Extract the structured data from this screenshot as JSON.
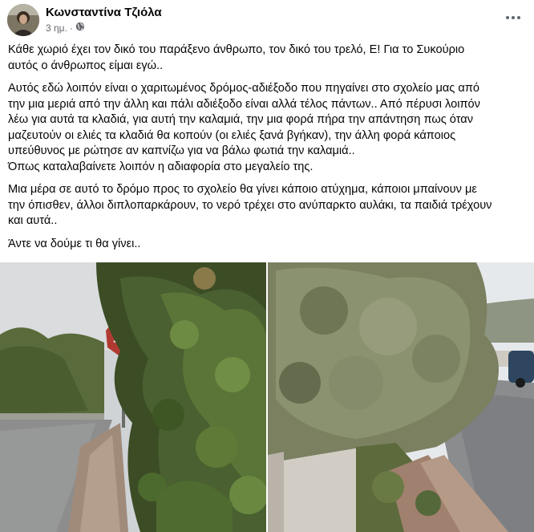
{
  "post": {
    "author": "Κωνσταντίνα Τζιόλα",
    "time": "3 ημ.",
    "separator": "·",
    "paragraphs": [
      "Κάθε χωριό έχει τον δικό του παράξενο άνθρωπο, τον δικό του τρελό, Ε! Για το Συκούριο\nαυτός ο άνθρωπος είμαι εγώ..",
      "Αυτός εδώ λοιπόν είναι ο χαριτωμένος δρόμος-αδιέξοδο που πηγαίνει στο σχολείο μας από\nτην μια μεριά από την άλλη και πάλι αδιέξοδο είναι αλλά τέλος πάντων.. Από πέρυσι λοιπόν\nλέω για αυτά τα κλαδιά, για αυτή την καλαμιά, την μια φορά πήρα την απάντηση πως όταν\nμαζευτούν οι ελιές τα κλαδιά θα κοπούν (οι ελιές ξανά βγήκαν), την άλλη φορά κάποιος\nυπεύθυνος με ρώτησε αν καπνίζω για να βάλω φωτιά την καλαμιά..\nΌπως καταλαβαίνετε λοιπόν η αδιαφορία στο μεγαλείο της.",
      "Μια μέρα σε αυτό το δρόμο προς το σχολείο θα γίνει κάποιο ατύχημα, κάποιοι μπαίνουν με\nτην όπισθεν, άλλοι διπλοπαρκάρουν, το νερό τρέχει στο ανύπαρκτο αυλάκι, τα παιδιά τρέχουν\nκαι αυτά..",
      "Άντε να δούμε τι θα γίνει.."
    ],
    "photos": [
      {
        "icon": "street-with-overgrown-hedge-photo"
      },
      {
        "icon": "olive-tree-over-wall-photo"
      }
    ]
  },
  "colors": {
    "text": "#050505",
    "secondary": "#65676b"
  }
}
